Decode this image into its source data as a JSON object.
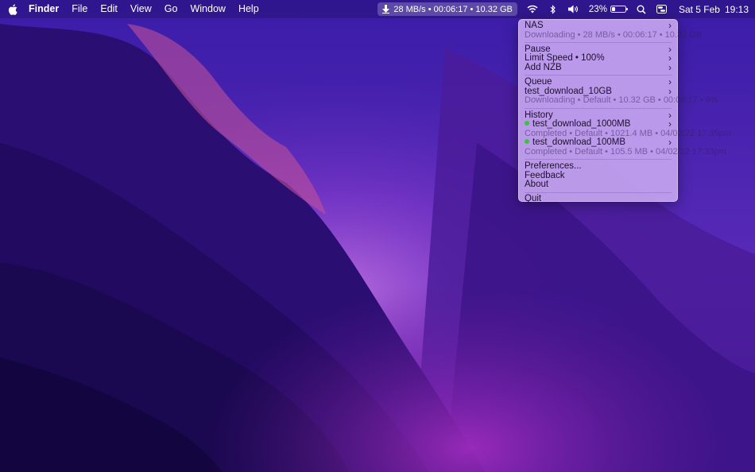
{
  "menubar": {
    "app_name": "Finder",
    "menus": [
      "File",
      "Edit",
      "View",
      "Go",
      "Window",
      "Help"
    ],
    "status_item": "28 MB/s • 00:06:17 • 10.32 GB",
    "battery_percent": "23%",
    "battery_level": 0.23,
    "date": "Sat 5 Feb",
    "time": "19:13"
  },
  "menu": {
    "server": {
      "label": "NAS",
      "status": "Downloading • 28 MB/s • 00:06:17 • 10.32 GB"
    },
    "actions": [
      "Pause",
      "Limit Speed • 100%",
      "Add NZB"
    ],
    "queue": {
      "label": "Queue",
      "item_name": "test_download_10GB",
      "item_status": "Downloading • Default • 10.32 GB • 00:06:17 • 9%"
    },
    "history": {
      "label": "History",
      "items": [
        {
          "name": "test_download_1000MB",
          "status": "Completed • Default • 1021.4 MB • 04/02/22 17:35pm"
        },
        {
          "name": "test_download_100MB",
          "status": "Completed • Default • 105.5 MB • 04/02/22 17:33pm"
        }
      ]
    },
    "app_items": [
      "Preferences...",
      "Feedback",
      "About"
    ],
    "quit": "Quit"
  },
  "colors": {
    "menu_bg": "#c4a4f0",
    "completed_dot": "#3fc03f",
    "wallpaper_base": "#2a0f6a"
  }
}
